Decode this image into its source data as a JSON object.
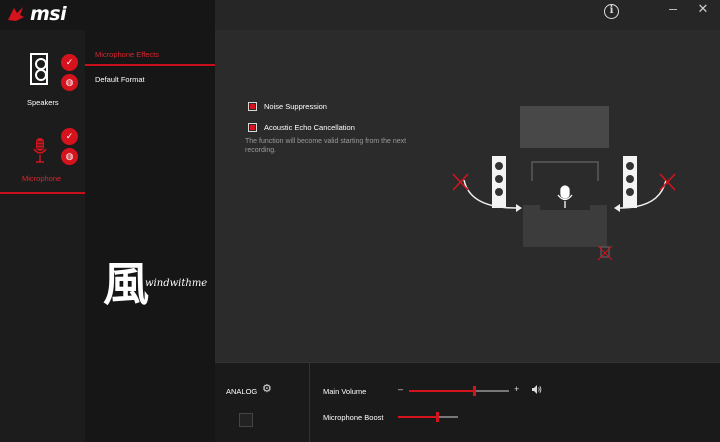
{
  "app": {
    "logo_text": "msi"
  },
  "header": {
    "info_label": "i"
  },
  "devices": [
    {
      "id": "speakers",
      "label": "Speakers",
      "badge_top": "✓",
      "badge_bottom": "◍"
    },
    {
      "id": "microphone",
      "label": "Microphone",
      "badge_top": "✓",
      "badge_bottom": "◍"
    }
  ],
  "menu": {
    "items": [
      {
        "label": "Microphone Effects"
      },
      {
        "label": "Default Format"
      }
    ]
  },
  "watermark": {
    "char": "風",
    "text": "windwithme"
  },
  "effects": {
    "noise_suppression": {
      "label": "Noise Suppression",
      "checked": true
    },
    "echo_cancellation": {
      "label": "Acoustic Echo Cancellation",
      "checked": true
    },
    "note": "The function will become valid starting from the next recording."
  },
  "bottom": {
    "analog_label": "ANALOG",
    "main_volume": {
      "label": "Main Volume",
      "minus": "–",
      "plus": "+",
      "value_percent": 65
    },
    "mic_boost": {
      "label": "Microphone Boost",
      "value_percent": 65
    }
  },
  "colors": {
    "accent": "#d5131d",
    "panel_dark": "#161616",
    "panel_main": "#2b2b2b"
  }
}
